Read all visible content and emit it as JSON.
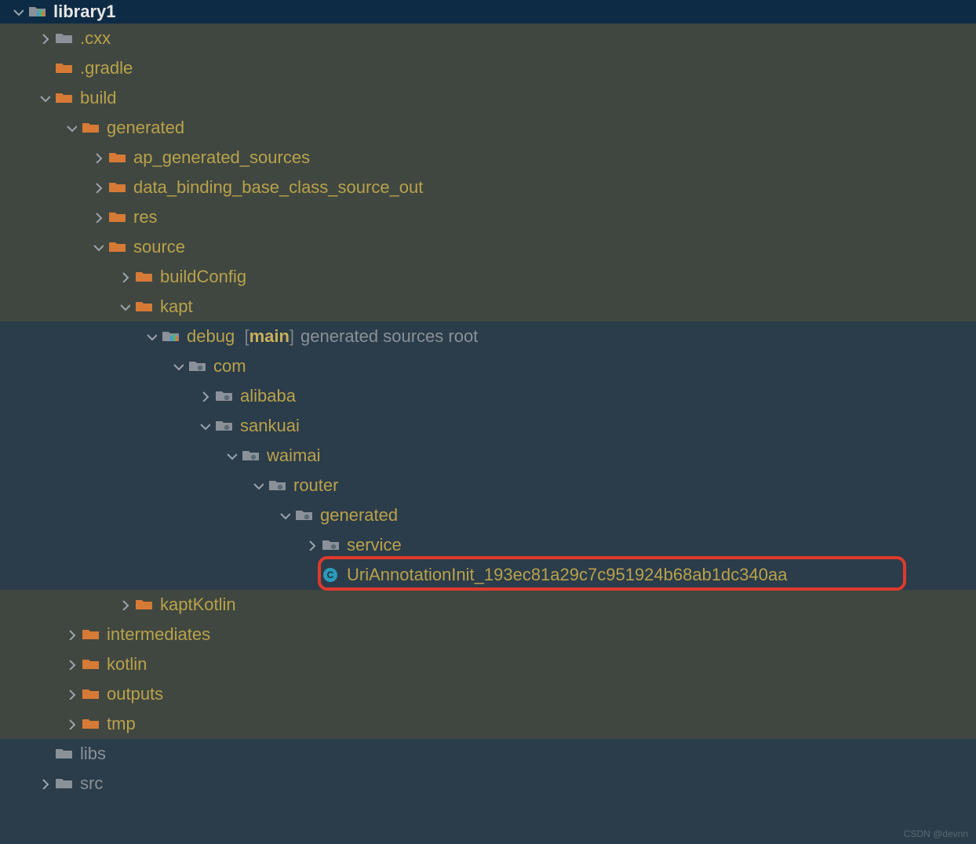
{
  "root": {
    "label": "library1"
  },
  "nodes": {
    "cxx": ".cxx",
    "gradle": ".gradle",
    "build": "build",
    "generated": "generated",
    "ap_generated_sources": "ap_generated_sources",
    "data_binding": "data_binding_base_class_source_out",
    "res": "res",
    "source": "source",
    "buildConfig": "buildConfig",
    "kapt": "kapt",
    "debug": "debug",
    "debug_bracket": "[",
    "debug_main": "main",
    "debug_bracket_close": "]",
    "debug_suffix": "generated sources root",
    "com": "com",
    "alibaba": "alibaba",
    "sankuai": "sankuai",
    "waimai": "waimai",
    "router": "router",
    "generated2": "generated",
    "service": "service",
    "uri_file": "UriAnnotationInit_193ec81a29c7c951924b68ab1dc340aa",
    "kaptKotlin": "kaptKotlin",
    "intermediates": "intermediates",
    "kotlin": "kotlin",
    "outputs": "outputs",
    "tmp": "tmp",
    "libs": "libs",
    "src": "src"
  },
  "watermark": "CSDN @devnn",
  "colors": {
    "folder_orange": "#d67a36",
    "folder_grey": "#8a9199",
    "class_icon": "#2a9bb8",
    "arrow": "#9aa4ad"
  }
}
